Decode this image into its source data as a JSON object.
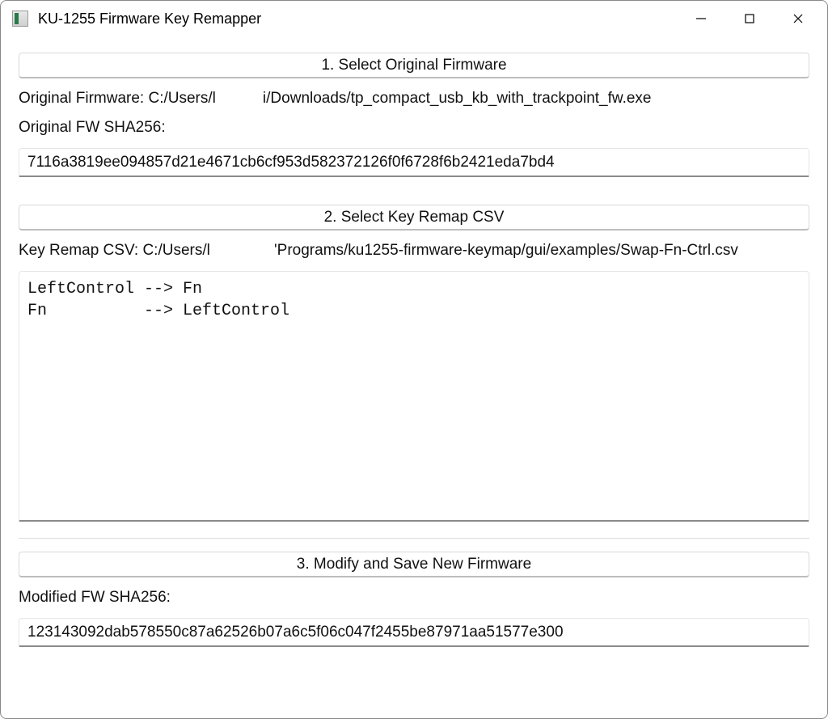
{
  "window": {
    "title": "KU-1255 Firmware Key Remapper"
  },
  "section1": {
    "button_label": "1. Select Original Firmware",
    "firmware_path_label": "Original Firmware: C:/Users/l           i/Downloads/tp_compact_usb_kb_with_trackpoint_fw.exe",
    "sha_label": "Original FW SHA256:",
    "sha_value": "7116a3819ee094857d21e4671cb6cf953d582372126f0f6728f6b2421eda7bd4"
  },
  "section2": {
    "button_label": "2. Select Key Remap CSV",
    "csv_path_label": "Key Remap CSV: C:/Users/l               'Programs/ku1255-firmware-keymap/gui/examples/Swap-Fn-Ctrl.csv",
    "mapping_text": "LeftControl --> Fn\nFn          --> LeftControl"
  },
  "section3": {
    "button_label": "3. Modify and Save New Firmware",
    "sha_label": "Modified FW SHA256:",
    "sha_value": "123143092dab578550c87a62526b07a6c5f06c047f2455be87971aa51577e300"
  }
}
